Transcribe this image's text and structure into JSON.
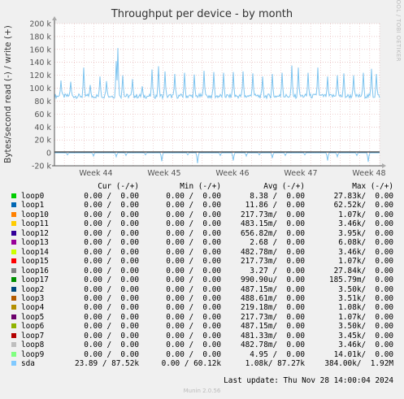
{
  "chart_data": {
    "type": "line",
    "title": "Throughput per device - by month",
    "ylabel": "Bytes/second read (-) / write (+)",
    "ylim": [
      -20000,
      200000
    ],
    "y_ticks": [
      "200 k",
      "180 k",
      "160 k",
      "140 k",
      "120 k",
      "100 k",
      "80 k",
      "60 k",
      "40 k",
      "20 k",
      "0",
      "-20 k"
    ],
    "y_tick_values": [
      200000,
      180000,
      160000,
      140000,
      120000,
      100000,
      80000,
      60000,
      40000,
      20000,
      0,
      -20000
    ],
    "x_ticks": [
      "Week 44",
      "Week 45",
      "Week 46",
      "Week 47",
      "Week 48"
    ],
    "grid": true,
    "series": [
      {
        "name": "sda",
        "color": "#7ec4ef",
        "write_baseline": 87270,
        "write_max": 162000,
        "write_spikes": [
          [
            0.02,
            112000
          ],
          [
            0.05,
            110000
          ],
          [
            0.09,
            132000
          ],
          [
            0.11,
            105000
          ],
          [
            0.14,
            118000
          ],
          [
            0.16,
            111000
          ],
          [
            0.19,
            142000
          ],
          [
            0.195,
            162000
          ],
          [
            0.21,
            120000
          ],
          [
            0.24,
            114000
          ],
          [
            0.27,
            103000
          ],
          [
            0.3,
            129000
          ],
          [
            0.32,
            134000
          ],
          [
            0.34,
            126000
          ],
          [
            0.37,
            122000
          ],
          [
            0.4,
            124000
          ],
          [
            0.43,
            121000
          ],
          [
            0.46,
            127000
          ],
          [
            0.49,
            125000
          ],
          [
            0.52,
            124000
          ],
          [
            0.55,
            125000
          ],
          [
            0.58,
            126000
          ],
          [
            0.61,
            123000
          ],
          [
            0.64,
            118000
          ],
          [
            0.67,
            122000
          ],
          [
            0.7,
            124000
          ],
          [
            0.73,
            135000
          ],
          [
            0.75,
            132000
          ],
          [
            0.78,
            124000
          ],
          [
            0.81,
            132000
          ],
          [
            0.84,
            118000
          ],
          [
            0.87,
            120000
          ],
          [
            0.89,
            123000
          ],
          [
            0.92,
            120000
          ],
          [
            0.95,
            124000
          ],
          [
            0.975,
            130000
          ],
          [
            0.99,
            122000
          ]
        ],
        "read_spikes": [
          [
            0.04,
            -3000
          ],
          [
            0.12,
            -5000
          ],
          [
            0.19,
            -6000
          ],
          [
            0.22,
            -4000
          ],
          [
            0.28,
            -3000
          ],
          [
            0.33,
            -13000
          ],
          [
            0.41,
            -3000
          ],
          [
            0.44,
            -16000
          ],
          [
            0.51,
            -4000
          ],
          [
            0.55,
            -12000
          ],
          [
            0.59,
            -5000
          ],
          [
            0.63,
            -3000
          ],
          [
            0.67,
            -8000
          ],
          [
            0.71,
            -4000
          ],
          [
            0.77,
            -3000
          ],
          [
            0.84,
            -12000
          ],
          [
            0.87,
            -6000
          ],
          [
            0.93,
            -4000
          ],
          [
            0.965,
            -14000
          ]
        ]
      }
    ]
  },
  "legend": {
    "headers": {
      "cur": "Cur (-/+)",
      "min": "Min (-/+)",
      "avg": "Avg (-/+)",
      "max": "Max (-/+)"
    },
    "rows": [
      {
        "name": "loop0",
        "color": "#00cc00",
        "cur": "0.00 /  0.00",
        "min": "0.00 /  0.00",
        "avg": "8.38 /  0.00",
        "max": "27.83k/  0.00"
      },
      {
        "name": "loop1",
        "color": "#0066b3",
        "cur": "0.00 /  0.00",
        "min": "0.00 /  0.00",
        "avg": "11.86 /  0.00",
        "max": "62.52k/  0.00"
      },
      {
        "name": "loop10",
        "color": "#ff8000",
        "cur": "0.00 /  0.00",
        "min": "0.00 /  0.00",
        "avg": "217.73m/  0.00",
        "max": "1.07k/  0.00"
      },
      {
        "name": "loop11",
        "color": "#ffcc00",
        "cur": "0.00 /  0.00",
        "min": "0.00 /  0.00",
        "avg": "483.15m/  0.00",
        "max": "3.46k/  0.00"
      },
      {
        "name": "loop12",
        "color": "#330099",
        "cur": "0.00 /  0.00",
        "min": "0.00 /  0.00",
        "avg": "656.82m/  0.00",
        "max": "3.95k/  0.00"
      },
      {
        "name": "loop13",
        "color": "#990099",
        "cur": "0.00 /  0.00",
        "min": "0.00 /  0.00",
        "avg": "2.68 /  0.00",
        "max": "6.08k/  0.00"
      },
      {
        "name": "loop14",
        "color": "#ccff00",
        "cur": "0.00 /  0.00",
        "min": "0.00 /  0.00",
        "avg": "482.78m/  0.00",
        "max": "3.46k/  0.00"
      },
      {
        "name": "loop15",
        "color": "#ff0000",
        "cur": "0.00 /  0.00",
        "min": "0.00 /  0.00",
        "avg": "217.73m/  0.00",
        "max": "1.07k/  0.00"
      },
      {
        "name": "loop16",
        "color": "#808080",
        "cur": "0.00 /  0.00",
        "min": "0.00 /  0.00",
        "avg": "3.27 /  0.00",
        "max": "27.84k/  0.00"
      },
      {
        "name": "loop17",
        "color": "#008f00",
        "cur": "0.00 /  0.00",
        "min": "0.00 /  0.00",
        "avg": "990.90u/  0.00",
        "max": "185.79m/  0.00"
      },
      {
        "name": "loop2",
        "color": "#00487d",
        "cur": "0.00 /  0.00",
        "min": "0.00 /  0.00",
        "avg": "487.15m/  0.00",
        "max": "3.50k/  0.00"
      },
      {
        "name": "loop3",
        "color": "#b35a00",
        "cur": "0.00 /  0.00",
        "min": "0.00 /  0.00",
        "avg": "488.61m/  0.00",
        "max": "3.51k/  0.00"
      },
      {
        "name": "loop4",
        "color": "#b38f00",
        "cur": "0.00 /  0.00",
        "min": "0.00 /  0.00",
        "avg": "219.18m/  0.00",
        "max": "1.08k/  0.00"
      },
      {
        "name": "loop5",
        "color": "#6b006b",
        "cur": "0.00 /  0.00",
        "min": "0.00 /  0.00",
        "avg": "217.73m/  0.00",
        "max": "1.07k/  0.00"
      },
      {
        "name": "loop6",
        "color": "#8fb300",
        "cur": "0.00 /  0.00",
        "min": "0.00 /  0.00",
        "avg": "487.15m/  0.00",
        "max": "3.50k/  0.00"
      },
      {
        "name": "loop7",
        "color": "#b30000",
        "cur": "0.00 /  0.00",
        "min": "0.00 /  0.00",
        "avg": "481.33m/  0.00",
        "max": "3.45k/  0.00"
      },
      {
        "name": "loop8",
        "color": "#bebebe",
        "cur": "0.00 /  0.00",
        "min": "0.00 /  0.00",
        "avg": "482.78m/  0.00",
        "max": "3.46k/  0.00"
      },
      {
        "name": "loop9",
        "color": "#80ff80",
        "cur": "0.00 /  0.00",
        "min": "0.00 /  0.00",
        "avg": "4.95 /  0.00",
        "max": "14.01k/  0.00"
      },
      {
        "name": "sda",
        "color": "#80c9ff",
        "cur": "23.89 / 87.52k",
        "min": "0.00 / 60.12k",
        "avg": "1.08k/ 87.27k",
        "max": "384.00k/  1.92M"
      }
    ]
  },
  "footer": {
    "last_update": "Last update: Thu Nov 28 14:00:04 2024",
    "munin": "Munin 2.0.56"
  },
  "side_label": "RRDTOOL / TOBI OETIKER"
}
